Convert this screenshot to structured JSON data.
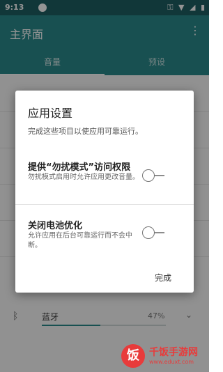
{
  "status_bar": {
    "time": "9:13",
    "icons": [
      "notification-icon",
      "key-icon",
      "wifi-icon",
      "signal-icon",
      "battery-icon"
    ]
  },
  "app_bar": {
    "title": "主界面",
    "overflow_icon": "more-vertical-icon"
  },
  "tabs": [
    {
      "label": "音量",
      "selected": true
    },
    {
      "label": "预设",
      "selected": false
    }
  ],
  "background": {
    "bluetooth_row": {
      "label": "蓝牙",
      "value": "47%",
      "level": 0.47,
      "icon": "bluetooth-icon",
      "chevron": "chevron-down-icon"
    }
  },
  "dialog": {
    "title": "应用设置",
    "subtitle": "完成这些项目以使应用可靠运行。",
    "settings": [
      {
        "title": "提供“勿扰模式”访问权限",
        "description": "勿扰模式启用时允许应用更改音量。",
        "enabled": false
      },
      {
        "title": "关闭电池优化",
        "description": "允许应用在后台可靠运行而不会中断。",
        "enabled": false
      }
    ],
    "done_label": "完成"
  },
  "watermark": {
    "badge": "饭",
    "title": "千饭手游网",
    "url": "www.eduxt.com"
  },
  "colors": {
    "primary": "#2a8a8c",
    "status_bar": "#1e5f63",
    "scrim": "rgba(0,0,0,0.42)",
    "watermark_red": "#e83b3b"
  }
}
